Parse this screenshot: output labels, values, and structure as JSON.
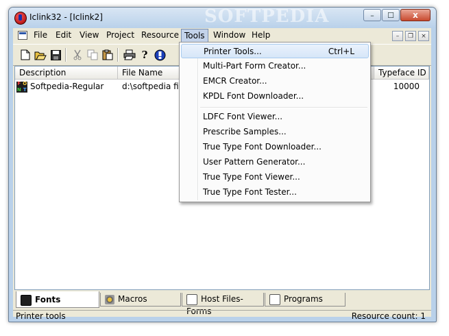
{
  "window": {
    "title": "Iclink32 - [Iclink2]",
    "watermark": "SOFTPEDIA",
    "min_label": "–",
    "max_label": "☐",
    "close_label": "x"
  },
  "menubar": {
    "items": [
      "File",
      "Edit",
      "View",
      "Project",
      "Resource",
      "Tools",
      "Window",
      "Help"
    ],
    "active": "Tools",
    "mdi_min": "–",
    "mdi_restore": "❐",
    "mdi_close": "×"
  },
  "toolbar": {
    "icons": [
      "new-icon",
      "open-icon",
      "save-icon",
      "cut-icon",
      "copy-icon",
      "paste-icon",
      "print-icon",
      "help-icon",
      "info-icon"
    ]
  },
  "list": {
    "columns": [
      "Description",
      "File Name",
      "Typeface ID"
    ],
    "rows": [
      {
        "icon": "font-file-icon",
        "description": "Softpedia-Regular",
        "filename": "d:\\softpedia file",
        "typeface_id": "10000"
      }
    ]
  },
  "tools_menu": {
    "items": [
      {
        "label": "Printer Tools...",
        "shortcut": "Ctrl+L",
        "highlighted": true
      },
      {
        "label": "Multi-Part Form Creator...",
        "shortcut": ""
      },
      {
        "label": "EMCR Creator...",
        "shortcut": ""
      },
      {
        "label": "KPDL Font Downloader...",
        "shortcut": ""
      },
      {
        "label": "LDFC Font Viewer...",
        "shortcut": ""
      },
      {
        "label": "Prescribe Samples...",
        "shortcut": ""
      },
      {
        "label": "True Type Font Downloader...",
        "shortcut": ""
      },
      {
        "label": "User Pattern Generator...",
        "shortcut": ""
      },
      {
        "label": "True Type Font Viewer...",
        "shortcut": ""
      },
      {
        "label": "True Type Font Tester...",
        "shortcut": ""
      }
    ]
  },
  "font_icon_letters": [
    "F",
    "O",
    "N",
    "T"
  ],
  "tabs": [
    {
      "label": "Fonts",
      "icon": "fonts-icon",
      "active": true
    },
    {
      "label": "Macros",
      "icon": "macros-icon",
      "active": false
    },
    {
      "label": "Host Files-Forms",
      "icon": "host-files-icon",
      "active": false
    },
    {
      "label": "Programs",
      "icon": "programs-icon",
      "active": false
    }
  ],
  "status": {
    "left": "Printer tools",
    "right": "Resource count:  1"
  },
  "colors": {
    "title_bar": "#b9d1ea",
    "menu_highlight": "#c3d3ea",
    "close_button": "#c8492e",
    "face": "#ece9d8"
  }
}
